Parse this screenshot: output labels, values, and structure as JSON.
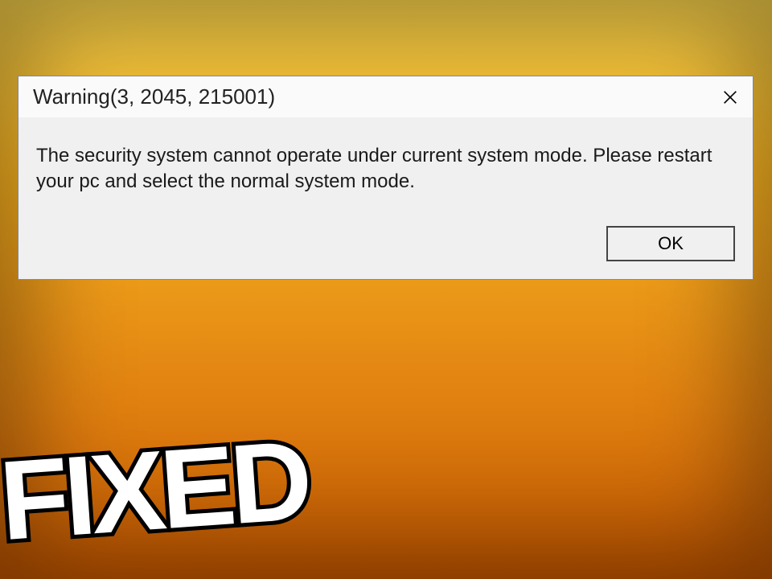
{
  "dialog": {
    "title": "Warning(3, 2045, 215001)",
    "message": "The security system cannot operate under current system mode. Please restart your pc and select the normal system mode.",
    "ok_label": "OK"
  },
  "overlay": {
    "fixed_text": "FIXED"
  }
}
